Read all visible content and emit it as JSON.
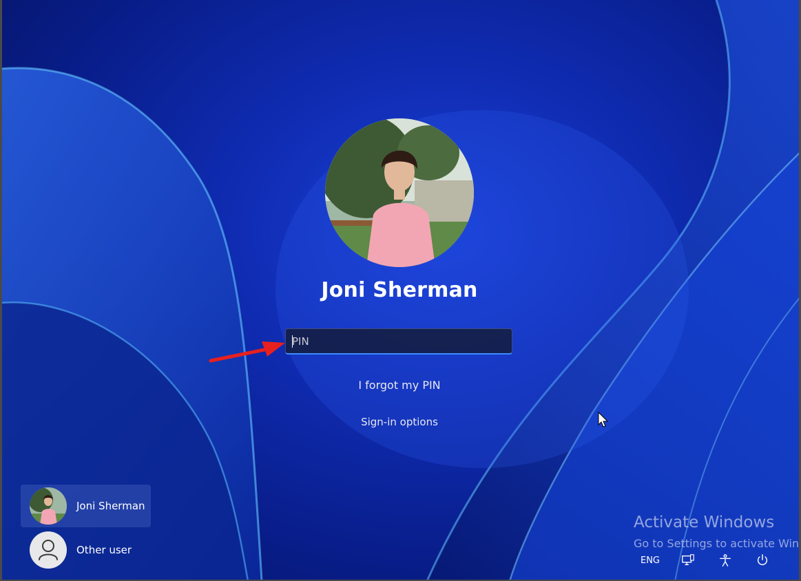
{
  "login": {
    "user_name": "Joni Sherman",
    "pin_placeholder": "PIN",
    "pin_value": "",
    "forgot_pin_link": "I forgot my PIN",
    "signin_options_link": "Sign-in options"
  },
  "user_switcher": {
    "users": [
      {
        "label": "Joni Sherman",
        "selected": true,
        "avatar": "photo-avatar"
      },
      {
        "label": "Other user",
        "selected": false,
        "avatar": "person-icon"
      }
    ]
  },
  "watermark": {
    "title": "Activate Windows",
    "subtitle": "Go to Settings to activate Windows."
  },
  "tray": {
    "language": "ENG",
    "icons": [
      "network-icon",
      "accessibility-icon",
      "power-icon"
    ]
  },
  "annotation": {
    "arrow_color": "#e8201f"
  },
  "colors": {
    "background": "#0f2bb0",
    "input_focus": "#3d8bff",
    "text": "#ffffff"
  }
}
